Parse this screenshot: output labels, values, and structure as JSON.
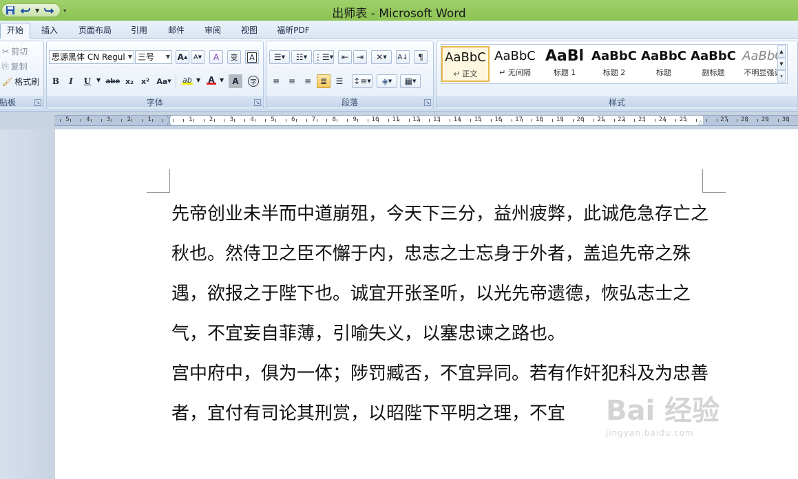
{
  "window": {
    "title": "出师表 - Microsoft Word"
  },
  "tabs": [
    {
      "label": "开始",
      "active": true
    },
    {
      "label": "插入"
    },
    {
      "label": "页面布局"
    },
    {
      "label": "引用"
    },
    {
      "label": "邮件"
    },
    {
      "label": "审阅"
    },
    {
      "label": "视图"
    },
    {
      "label": "福昕PDF"
    }
  ],
  "clipboard": {
    "label": "贴板",
    "cut": "剪切",
    "copy": "复制",
    "format_painter": "格式刷"
  },
  "font_group": {
    "label": "字体",
    "font_name": "思源黑体 CN Regul",
    "font_size": "三号",
    "grow_font": "A",
    "shrink_font": "A",
    "clear_format": "A",
    "phonetic": "变",
    "char_border": "A",
    "bold": "B",
    "italic": "I",
    "underline": "U",
    "strike": "abe",
    "subscript": "x₂",
    "superscript": "x²",
    "change_case": "Aa",
    "highlight": "ab",
    "font_color": "A",
    "char_shading": "A",
    "enclose": "字",
    "highlight_color": "#f5f000",
    "font_color_value": "#e02020"
  },
  "paragraph_group": {
    "label": "段落"
  },
  "styles_group": {
    "label": "样式",
    "items": [
      {
        "sample": "AaBbC",
        "name": "↵ 正文"
      },
      {
        "sample": "AaBbC",
        "name": "↵ 无间隔"
      },
      {
        "sample": "AaBl",
        "name": "标题 1"
      },
      {
        "sample": "AaBbC",
        "name": "标题 2"
      },
      {
        "sample": "AaBbC",
        "name": "标题"
      },
      {
        "sample": "AaBbC",
        "name": "副标题"
      },
      {
        "sample": "AaBbC",
        "name": "不明显强调"
      }
    ]
  },
  "ruler": {
    "left_numbers": [
      "5",
      "4",
      "3",
      "2",
      "1"
    ],
    "right_numbers": [
      "1",
      "2",
      "3",
      "4",
      "5",
      "6",
      "7",
      "8",
      "9",
      "10",
      "11",
      "12",
      "13",
      "14",
      "15",
      "16",
      "17",
      "18",
      "19",
      "20",
      "21",
      "22",
      "23",
      "24",
      "25",
      "",
      "27",
      "28",
      "29",
      "30"
    ]
  },
  "document": {
    "paragraphs": [
      "先帝创业未半而中道崩殂，今天下三分，益州疲弊，此诚危急存亡之秋也。然侍卫之臣不懈于内，忠志之士忘身于外者，盖追先帝之殊遇，欲报之于陛下也。诚宜开张圣听，以光先帝遗德，恢弘志士之气，不宜妄自菲薄，引喻失义，以塞忠谏之路也。",
      "宫中府中，俱为一体；陟罚臧否，不宜异同。若有作奸犯科及为忠善者，宜付有司论其刑赏，以昭陛下平明之理，不宜"
    ]
  },
  "watermark": {
    "main": "Bai 经验",
    "sub": "jingyan.baidu.com"
  }
}
